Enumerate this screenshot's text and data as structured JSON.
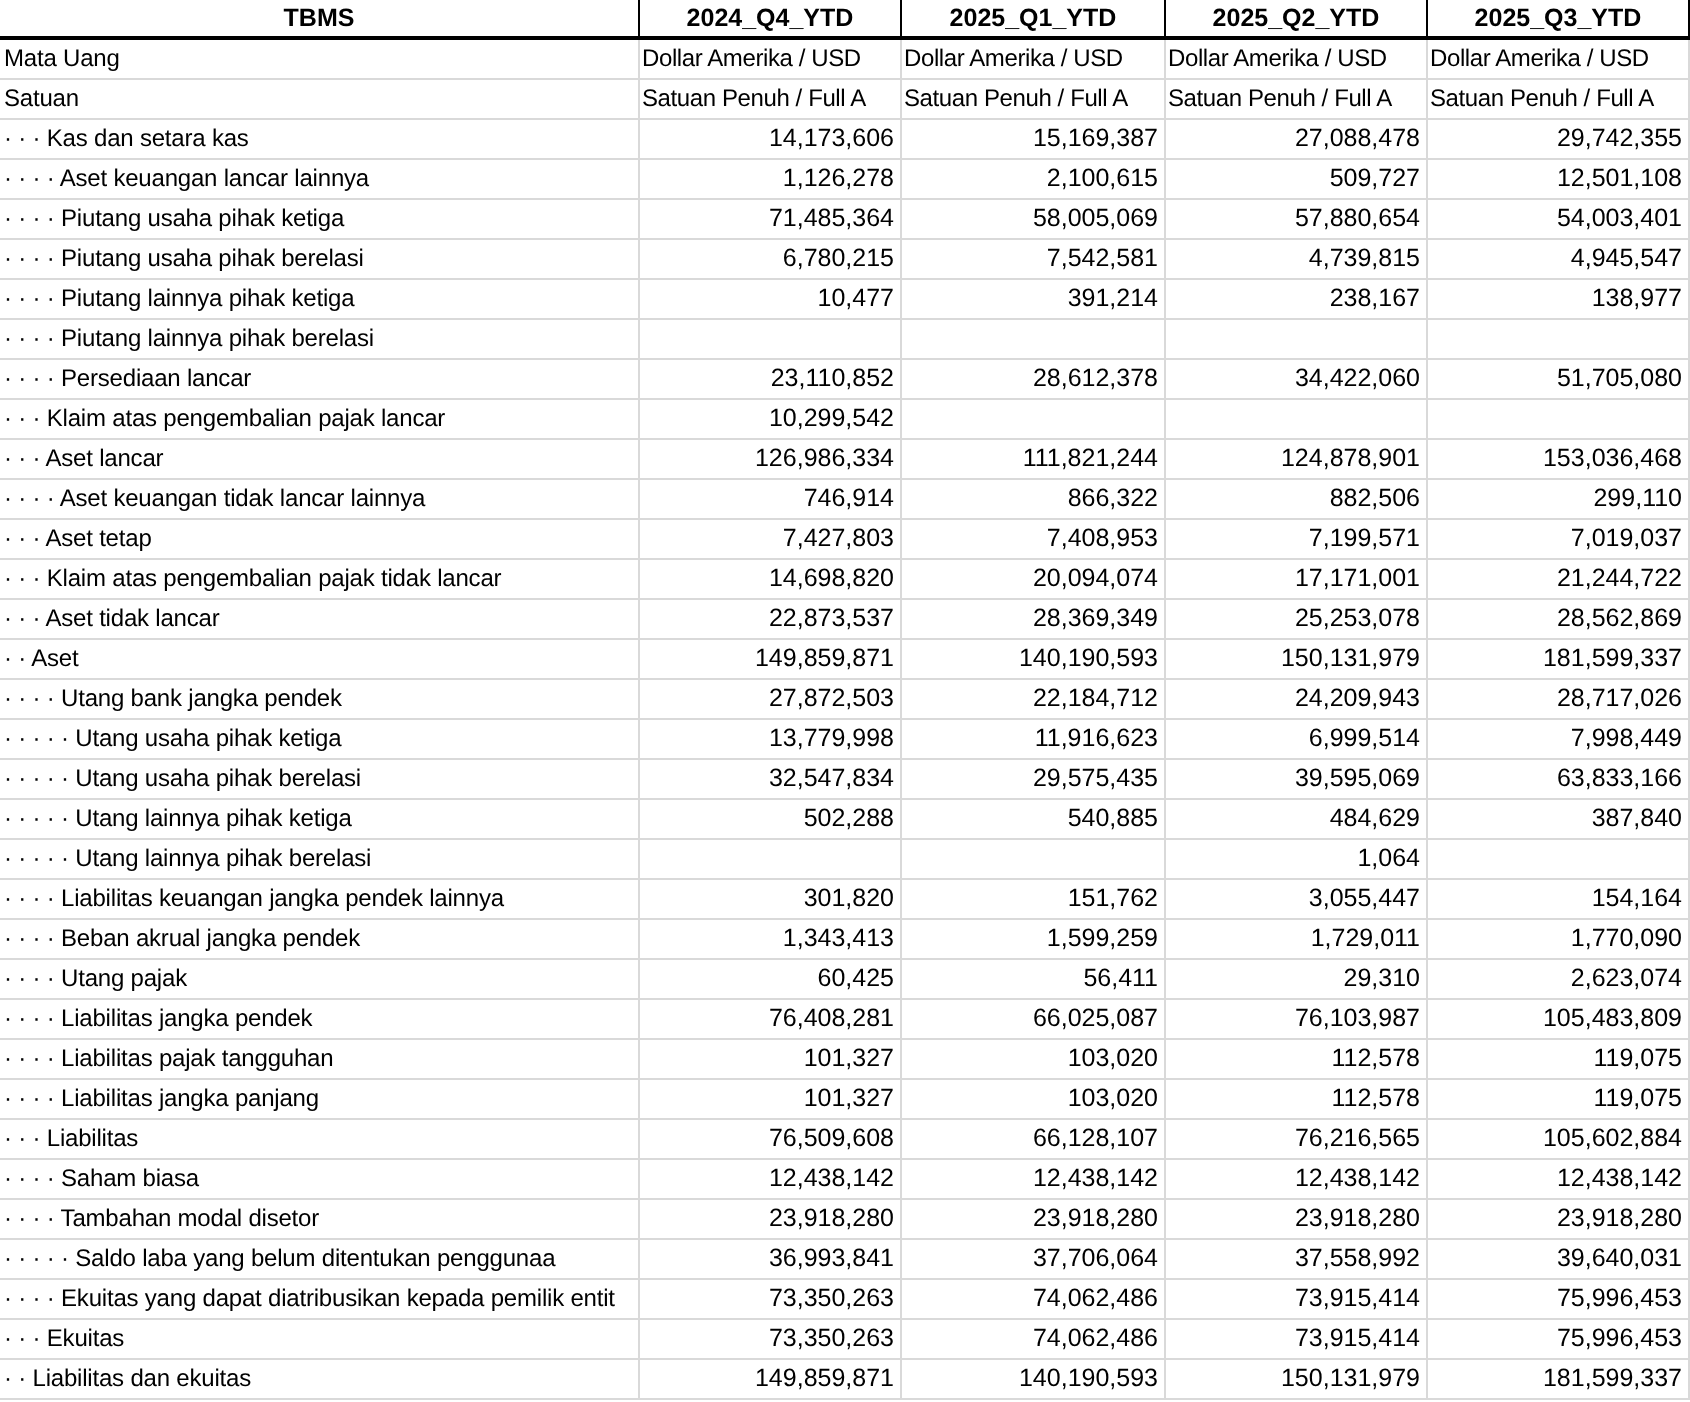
{
  "table": {
    "columns": [
      {
        "label": "TBMS"
      },
      {
        "label": "2024_Q4_YTD"
      },
      {
        "label": "2025_Q1_YTD"
      },
      {
        "label": "2025_Q2_YTD"
      },
      {
        "label": "2025_Q3_YTD"
      }
    ],
    "meta_rows": [
      {
        "label": "Mata Uang",
        "values": {
          "q4_2024": "Dollar Amerika / USD",
          "q1_2025": "Dollar Amerika / USD",
          "q2_2025": "Dollar Amerika / USD",
          "q3_2025": "Dollar Amerika / USD"
        }
      },
      {
        "label": "Satuan",
        "values": {
          "q4_2024": "Satuan Penuh / Full A",
          "q1_2025": "Satuan Penuh / Full A",
          "q2_2025": "Satuan Penuh / Full A",
          "q3_2025": "Satuan Penuh / Full A"
        }
      }
    ],
    "rows": [
      {
        "label": "· · · Kas dan setara kas",
        "values": {
          "q4_2024": "14,173,606",
          "q1_2025": "15,169,387",
          "q2_2025": "27,088,478",
          "q3_2025": "29,742,355"
        }
      },
      {
        "label": "· · · · Aset keuangan lancar lainnya",
        "values": {
          "q4_2024": "1,126,278",
          "q1_2025": "2,100,615",
          "q2_2025": "509,727",
          "q3_2025": "12,501,108"
        }
      },
      {
        "label": "· · · · Piutang usaha pihak ketiga",
        "values": {
          "q4_2024": "71,485,364",
          "q1_2025": "58,005,069",
          "q2_2025": "57,880,654",
          "q3_2025": "54,003,401"
        }
      },
      {
        "label": "· · · · Piutang usaha pihak berelasi",
        "values": {
          "q4_2024": "6,780,215",
          "q1_2025": "7,542,581",
          "q2_2025": "4,739,815",
          "q3_2025": "4,945,547"
        }
      },
      {
        "label": "· · · · Piutang lainnya pihak ketiga",
        "values": {
          "q4_2024": "10,477",
          "q1_2025": "391,214",
          "q2_2025": "238,167",
          "q3_2025": "138,977"
        }
      },
      {
        "label": "· · · · Piutang lainnya pihak berelasi",
        "values": [
          {
            "kind": "blank"
          },
          {
            "kind": "blank"
          },
          {
            "kind": "blank"
          },
          {
            "kind": "blank"
          }
        ]
      },
      {
        "label": "· · · · Persediaan lancar",
        "values": {
          "q4_2024": "23,110,852",
          "q1_2025": "28,612,378",
          "q2_2025": "34,422,060",
          "q3_2025": "51,705,080"
        }
      },
      {
        "label": "· · · Klaim atas pengembalian pajak lancar",
        "values": [
          {
            "kind": "value",
            "text": "10,299,542"
          },
          {
            "kind": "blank"
          },
          {
            "kind": "blank"
          },
          {
            "kind": "blank"
          }
        ]
      },
      {
        "label": "· · · Aset lancar",
        "values": {
          "q4_2024": "126,986,334",
          "q1_2025": "111,821,244",
          "q2_2025": "124,878,901",
          "q3_2025": "153,036,468"
        }
      },
      {
        "label": "· · · · Aset keuangan tidak lancar lainnya",
        "values": {
          "q4_2024": "746,914",
          "q1_2025": "866,322",
          "q2_2025": "882,506",
          "q3_2025": "299,110"
        }
      },
      {
        "label": "· · · Aset tetap",
        "values": {
          "q4_2024": "7,427,803",
          "q1_2025": "7,408,953",
          "q2_2025": "7,199,571",
          "q3_2025": "7,019,037"
        }
      },
      {
        "label": "· · · Klaim atas pengembalian pajak tidak lancar",
        "values": {
          "q4_2024": "14,698,820",
          "q1_2025": "20,094,074",
          "q2_2025": "17,171,001",
          "q3_2025": "21,244,722"
        }
      },
      {
        "label": "· · · Aset tidak lancar",
        "values": {
          "q4_2024": "22,873,537",
          "q1_2025": "28,369,349",
          "q2_2025": "25,253,078",
          "q3_2025": "28,562,869"
        }
      },
      {
        "label": "· · Aset",
        "values": {
          "q4_2024": "149,859,871",
          "q1_2025": "140,190,593",
          "q2_2025": "150,131,979",
          "q3_2025": "181,599,337"
        }
      },
      {
        "label": "· · · · Utang bank jangka pendek",
        "values": {
          "q4_2024": "27,872,503",
          "q1_2025": "22,184,712",
          "q2_2025": "24,209,943",
          "q3_2025": "28,717,026"
        }
      },
      {
        "label": "· · · · · Utang usaha pihak ketiga",
        "values": {
          "q4_2024": "13,779,998",
          "q1_2025": "11,916,623",
          "q2_2025": "6,999,514",
          "q3_2025": "7,998,449"
        }
      },
      {
        "label": "· · · · · Utang usaha pihak berelasi",
        "values": {
          "q4_2024": "32,547,834",
          "q1_2025": "29,575,435",
          "q2_2025": "39,595,069",
          "q3_2025": "63,833,166"
        }
      },
      {
        "label": "· · · · · Utang lainnya pihak ketiga",
        "values": {
          "q4_2024": "502,288",
          "q1_2025": "540,885",
          "q2_2025": "484,629",
          "q3_2025": "387,840"
        }
      },
      {
        "label": "· · · · · Utang lainnya pihak berelasi",
        "values": [
          {
            "kind": "blank"
          },
          {
            "kind": "blank"
          },
          {
            "kind": "value",
            "text": "1,064"
          },
          {
            "kind": "blank"
          }
        ]
      },
      {
        "label": "· · · · Liabilitas keuangan jangka pendek lainnya",
        "values": {
          "q4_2024": "301,820",
          "q1_2025": "151,762",
          "q2_2025": "3,055,447",
          "q3_2025": "154,164"
        }
      },
      {
        "label": "· · · · Beban akrual jangka pendek",
        "values": {
          "q4_2024": "1,343,413",
          "q1_2025": "1,599,259",
          "q2_2025": "1,729,011",
          "q3_2025": "1,770,090"
        }
      },
      {
        "label": "· · · · Utang pajak",
        "values": {
          "q4_2024": "60,425",
          "q1_2025": "56,411",
          "q2_2025": "29,310",
          "q3_2025": "2,623,074"
        }
      },
      {
        "label": "· · · · Liabilitas jangka pendek",
        "values": {
          "q4_2024": "76,408,281",
          "q1_2025": "66,025,087",
          "q2_2025": "76,103,987",
          "q3_2025": "105,483,809"
        }
      },
      {
        "label": "· · · · Liabilitas pajak tangguhan",
        "values": {
          "q4_2024": "101,327",
          "q1_2025": "103,020",
          "q2_2025": "112,578",
          "q3_2025": "119,075"
        }
      },
      {
        "label": "· · · · Liabilitas jangka panjang",
        "values": {
          "q4_2024": "101,327",
          "q1_2025": "103,020",
          "q2_2025": "112,578",
          "q3_2025": "119,075"
        }
      },
      {
        "label": "· · · Liabilitas",
        "values": {
          "q4_2024": "76,509,608",
          "q1_2025": "66,128,107",
          "q2_2025": "76,216,565",
          "q3_2025": "105,602,884"
        }
      },
      {
        "label": "· · · · Saham biasa",
        "values": {
          "q4_2024": "12,438,142",
          "q1_2025": "12,438,142",
          "q2_2025": "12,438,142",
          "q3_2025": "12,438,142"
        }
      },
      {
        "label": "· · · · Tambahan modal disetor",
        "values": {
          "q4_2024": "23,918,280",
          "q1_2025": "23,918,280",
          "q2_2025": "23,918,280",
          "q3_2025": "23,918,280"
        }
      },
      {
        "label": "· · · · · Saldo laba yang belum ditentukan penggunaa",
        "values": {
          "q4_2024": "36,993,841",
          "q1_2025": "37,706,064",
          "q2_2025": "37,558,992",
          "q3_2025": "39,640,031"
        }
      },
      {
        "label": "· · · · Ekuitas yang dapat diatribusikan kepada pemilik entit",
        "values": {
          "q4_2024": "73,350,263",
          "q1_2025": "74,062,486",
          "q2_2025": "73,915,414",
          "q3_2025": "75,996,453"
        }
      },
      {
        "label": "· · · Ekuitas",
        "values": {
          "q4_2024": "73,350,263",
          "q1_2025": "74,062,486",
          "q2_2025": "73,915,414",
          "q3_2025": "75,996,453"
        }
      },
      {
        "label": "· · Liabilitas dan ekuitas",
        "values": {
          "q4_2024": "149,859,871",
          "q1_2025": "140,190,593",
          "q2_2025": "150,131,979",
          "q3_2025": "181,599,337"
        }
      }
    ]
  }
}
